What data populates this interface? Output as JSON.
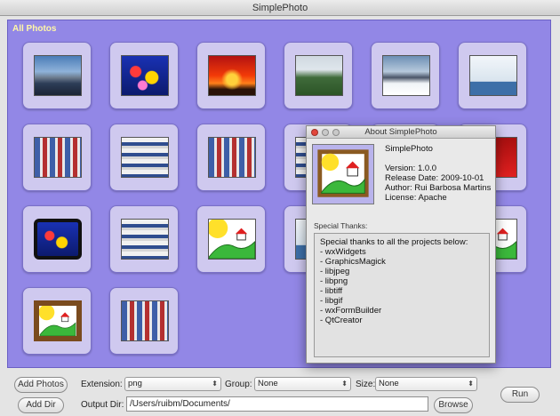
{
  "window": {
    "title": "SimplePhoto"
  },
  "gallery": {
    "title": "All Photos",
    "tiles": [
      {
        "kind": "ph-mountain"
      },
      {
        "kind": "ph-fish"
      },
      {
        "kind": "ph-sunset"
      },
      {
        "kind": "ph-field"
      },
      {
        "kind": "ph-snow"
      },
      {
        "kind": "ph-blank"
      },
      {
        "kind": "ph-screen"
      },
      {
        "kind": "ph-screen2"
      },
      {
        "kind": "ph-screen"
      },
      {
        "kind": "ph-screen2"
      },
      {
        "kind": "ph-screen"
      },
      {
        "kind": "ph-red"
      },
      {
        "kind": "ph-fishframe"
      },
      {
        "kind": "ph-screen2"
      },
      {
        "kind": "ph-art"
      },
      {
        "kind": "ph-blank"
      },
      {
        "kind": "ph-screen"
      },
      {
        "kind": "ph-art"
      },
      {
        "kind": "ph-frame"
      },
      {
        "kind": "ph-screen"
      }
    ]
  },
  "toolbar": {
    "add_photos": "Add Photos",
    "add_dir": "Add Dir",
    "extension_label": "Extension:",
    "extension_value": "png",
    "group_label": "Group:",
    "group_value": "None",
    "size_label": "Size:",
    "size_value": "None",
    "output_label": "Output Dir:",
    "output_value": "/Users/ruibm/Documents/",
    "browse": "Browse",
    "run": "Run"
  },
  "about": {
    "title": "About SimplePhoto",
    "app_name": "SimplePhoto",
    "version": "Version: 1.0.0",
    "release": "Release Date: 2009-10-01",
    "author": "Author: Rui Barbosa Martins",
    "license": "License: Apache",
    "thanks_label": "Special Thanks:",
    "thanks_intro": "Special thanks to all the projects below:",
    "projects": [
      "- wxWidgets",
      "- GraphicsMagick",
      "- libjpeg",
      "- libpng",
      "- libtiff",
      "- libgif",
      "- wxFormBuilder",
      "- QtCreator"
    ]
  }
}
